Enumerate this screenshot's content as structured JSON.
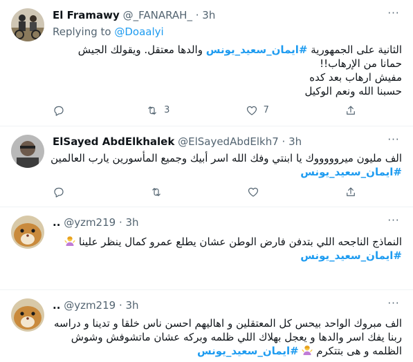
{
  "tweets": [
    {
      "name": "El Framawy",
      "handle": "@_FANARAH_",
      "time": "· 3h",
      "replying_label": "Replying to ",
      "replying_handle": "@Doaalyi",
      "lines": [
        {
          "pre": "الثانية على الجمهورية ",
          "tag": "#ايمان_سعيد_يونس",
          "post": "  والدها معتقل. ويقولك الجيش"
        },
        {
          "text": "حمانا من الإرهاب!!"
        },
        {
          "text": "مفيش ارهاب بعد كده"
        },
        {
          "text": "حسبنا الله ونعم الوكيل"
        }
      ],
      "replies": "",
      "retweets": "3",
      "likes": "7"
    },
    {
      "name": "ElSayed AbdElkhalek",
      "handle": "@ElSayedAbdElkh7",
      "time": "· 3h",
      "lines": [
        {
          "text": "الف مليون ميروووووك يا ابنتي وفك الله اسر أبيك وجميع المأسورين يارب العالمين"
        },
        {
          "tag": "#ايمان_سعيد_يونس"
        }
      ]
    },
    {
      "name": "..",
      "handle": "@yzm219",
      "time": "· 3h",
      "lines": [
        {
          "text": "النماذج الناجحه اللي بتدفن فارض الوطن عشان يطلع عمرو كمال ينظر علينا",
          "emoji": "woman-shrugging"
        },
        {
          "tag": "#ايمان_سعيد_يونس"
        }
      ]
    },
    {
      "name": "..",
      "handle": "@yzm219",
      "time": "· 3h",
      "lines": [
        {
          "text": "الف مبروك الواحد بيحس كل المعتقلين و اهاليهم احسن ناس خلقا و تدينا و دراسه"
        },
        {
          "text": "ربنا يفك اسر والدها و يعجل بهلاك اللي ظلمه وبركه عشان ماتشوفش وشوش"
        },
        {
          "pre": "الظلمه و هى بتتكرم ",
          "emoji": "woman-shrugging",
          "mid": " ",
          "tag": "#ايمان_سعيد_يونس"
        }
      ]
    }
  ],
  "icons": {
    "more": "more-icon",
    "reply": "reply-icon",
    "retweet": "retweet-icon",
    "like": "heart-icon",
    "share": "share-icon"
  },
  "colors": {
    "accent": "#1d9bf0",
    "text": "#0f1419",
    "muted": "#536471",
    "divider": "#eff3f4"
  }
}
